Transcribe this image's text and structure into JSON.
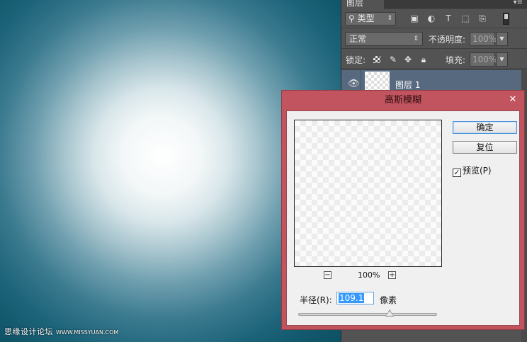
{
  "canvas": {
    "glow_color": "#ffffff",
    "bg_color": "#0e5266",
    "watermark": "思缘设计论坛",
    "watermark_url": "WWW.MISSYUAN.COM"
  },
  "layers_panel": {
    "tab_title": "图层",
    "menu_icon": "panel-menu-icon",
    "filter": {
      "kind_label": "类型",
      "icons": [
        "image-filter-icon",
        "adjustment-filter-icon",
        "type-filter-icon",
        "shape-filter-icon",
        "smart-object-filter-icon"
      ]
    },
    "blend_mode": "正常",
    "opacity_label": "不透明度:",
    "opacity_value": "100%",
    "lock_label": "锁定:",
    "fill_label": "填充:",
    "fill_value": "100%",
    "layers": [
      {
        "name": "图层 1",
        "visible": true,
        "selected": true
      }
    ]
  },
  "dialog": {
    "title": "高斯模糊",
    "ok_label": "确定",
    "reset_label": "复位",
    "preview_label": "预览(P)",
    "preview_checked": true,
    "zoom_out": "−",
    "zoom_in": "+",
    "zoom_value": "100%",
    "radius_label": "半径(R):",
    "radius_value": "109.1",
    "radius_unit": "像素",
    "radius_slider_fraction": 0.66,
    "title_bar_color": "#c1545f"
  }
}
